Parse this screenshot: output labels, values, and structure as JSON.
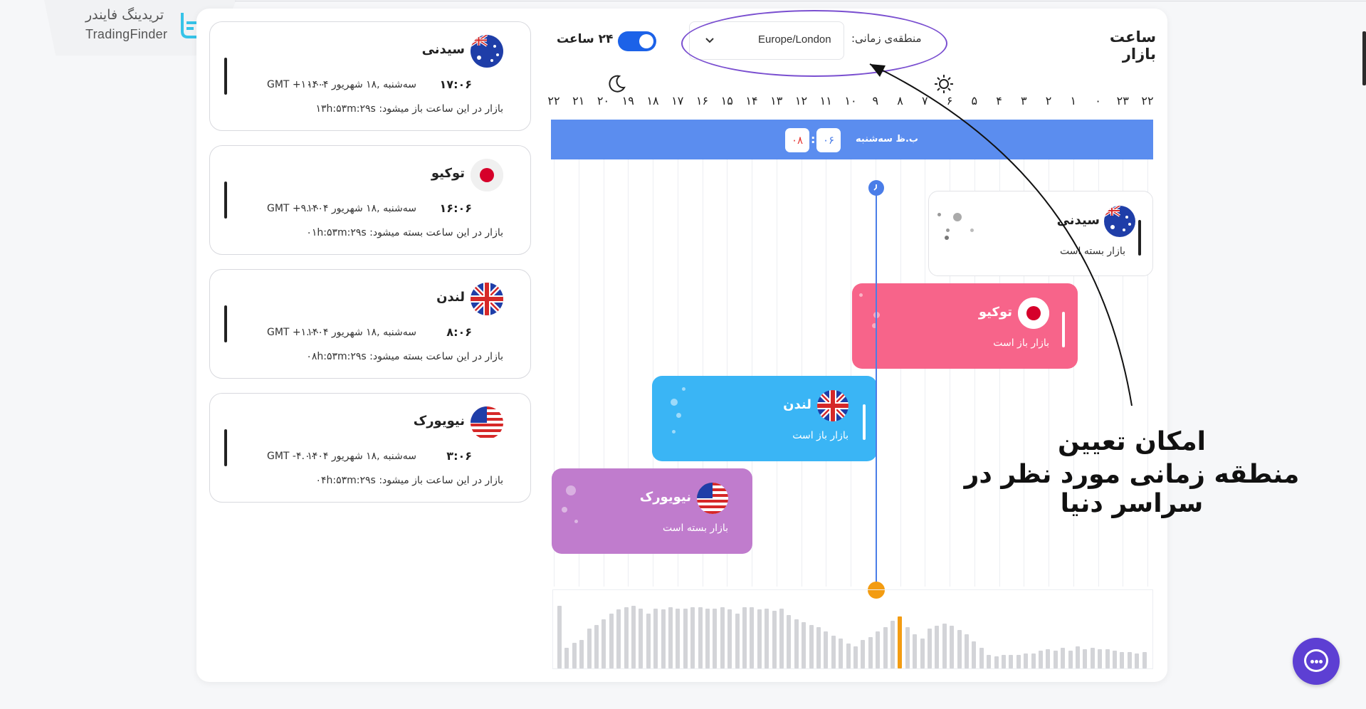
{
  "brand": {
    "name_fa": "تریدینگ فایندر",
    "name_en": "TradingFinder",
    "logo_icon": "tradingfinder-logo-icon"
  },
  "header": {
    "title": "ساعت بازار",
    "timezone_label": "منطقه‌ی زمانی:",
    "timezone_value": "Europe/London",
    "toggle_label": "۲۴ ساعت",
    "toggle_on": true
  },
  "hours": [
    "۲۲",
    "۲۳",
    "۰",
    "۱",
    "۲",
    "۳",
    "۴",
    "۵",
    "۶",
    "۷",
    "۸",
    "۹",
    "۱۰",
    "۱۱",
    "۱۲",
    "۱۳",
    "۱۴",
    "۱۵",
    "۱۶",
    "۱۷",
    "۱۸",
    "۱۹",
    "۲۰",
    "۲۱",
    "۲۲"
  ],
  "day_band": {
    "label": "ب.ظ سه‌شنبه",
    "hour": "۰۶",
    "minute": "۰۸",
    "colon": ":"
  },
  "market_cards": [
    {
      "name": "سیدنی",
      "time": "۱۷:۰۶",
      "date": "سه‌شنبه ,۱۸ شهریور ۱۴۰۴",
      "gmt": "GMT +۱۰.۰۰",
      "status": "بازار در این ساعت باز میشود:",
      "countdown": "۱۳h:۵۳m:۲۹s",
      "flag": "australia-flag-icon"
    },
    {
      "name": "توکیو",
      "time": "۱۶:۰۶",
      "date": "سه‌شنبه ,۱۸ شهریور ۱۴۰۴",
      "gmt": "GMT +۹.۰۰",
      "status": "بازار در این ساعت بسته میشود:",
      "countdown": "۰۱h:۵۳m:۲۹s",
      "flag": "japan-flag-icon"
    },
    {
      "name": "لندن",
      "time": "۸:۰۶",
      "date": "سه‌شنبه ,۱۸ شهریور ۱۴۰۴",
      "gmt": "GMT +۱.۰۰",
      "status": "بازار در این ساعت بسته میشود:",
      "countdown": "۰۸h:۵۳m:۲۹s",
      "flag": "uk-flag-icon"
    },
    {
      "name": "نیویورک",
      "time": "۳:۰۶",
      "date": "سه‌شنبه ,۱۸ شهریور ۱۴۰۴",
      "gmt": "GMT -۴.۰۰",
      "status": "بازار در این ساعت باز میشود:",
      "countdown": "۰۴h:۵۳m:۲۹s",
      "flag": "usa-flag-icon"
    }
  ],
  "sessions": [
    {
      "name": "سیدنی",
      "status": "بازار بسته است",
      "color": "#ffffff",
      "text_color": "#222222"
    },
    {
      "name": "توکیو",
      "status": "بازار باز است",
      "color": "#f7648a",
      "text_color": "#ffffff"
    },
    {
      "name": "لندن",
      "status": "بازار باز است",
      "color": "#3ab5f5",
      "text_color": "#ffffff"
    },
    {
      "name": "نیویورک",
      "status": "بازار بسته است",
      "color": "#c07ccd",
      "text_color": "#ffffff"
    }
  ],
  "volume_levels": [
    0.92,
    0.3,
    0.38,
    0.42,
    0.58,
    0.64,
    0.72,
    0.8,
    0.86,
    0.9,
    0.92,
    0.88,
    0.8,
    0.88,
    0.86,
    0.9,
    0.88,
    0.88,
    0.9,
    0.9,
    0.88,
    0.88,
    0.9,
    0.86,
    0.8,
    0.9,
    0.9,
    0.86,
    0.88,
    0.84,
    0.88,
    0.78,
    0.72,
    0.68,
    0.64,
    0.6,
    0.54,
    0.48,
    0.44,
    0.36,
    0.32,
    0.42,
    0.46,
    0.54,
    0.6,
    0.7,
    0.76,
    0.6,
    0.5,
    0.44,
    0.58,
    0.62,
    0.66,
    0.62,
    0.56,
    0.5,
    0.4,
    0.3,
    0.2,
    0.18,
    0.2,
    0.2,
    0.2,
    0.22,
    0.22,
    0.26,
    0.28,
    0.26,
    0.3,
    0.26,
    0.32,
    0.28,
    0.3,
    0.28,
    0.28,
    0.26,
    0.24,
    0.24,
    0.22,
    0.24
  ],
  "volume_highlight_index": 46,
  "annotation": {
    "line1": "امکان تعیین",
    "line2": "منطقه زمانی مورد نظر در سراسر دنیا",
    "color": "#7a4fd0"
  },
  "chat": {
    "icon": "chat-icon"
  }
}
